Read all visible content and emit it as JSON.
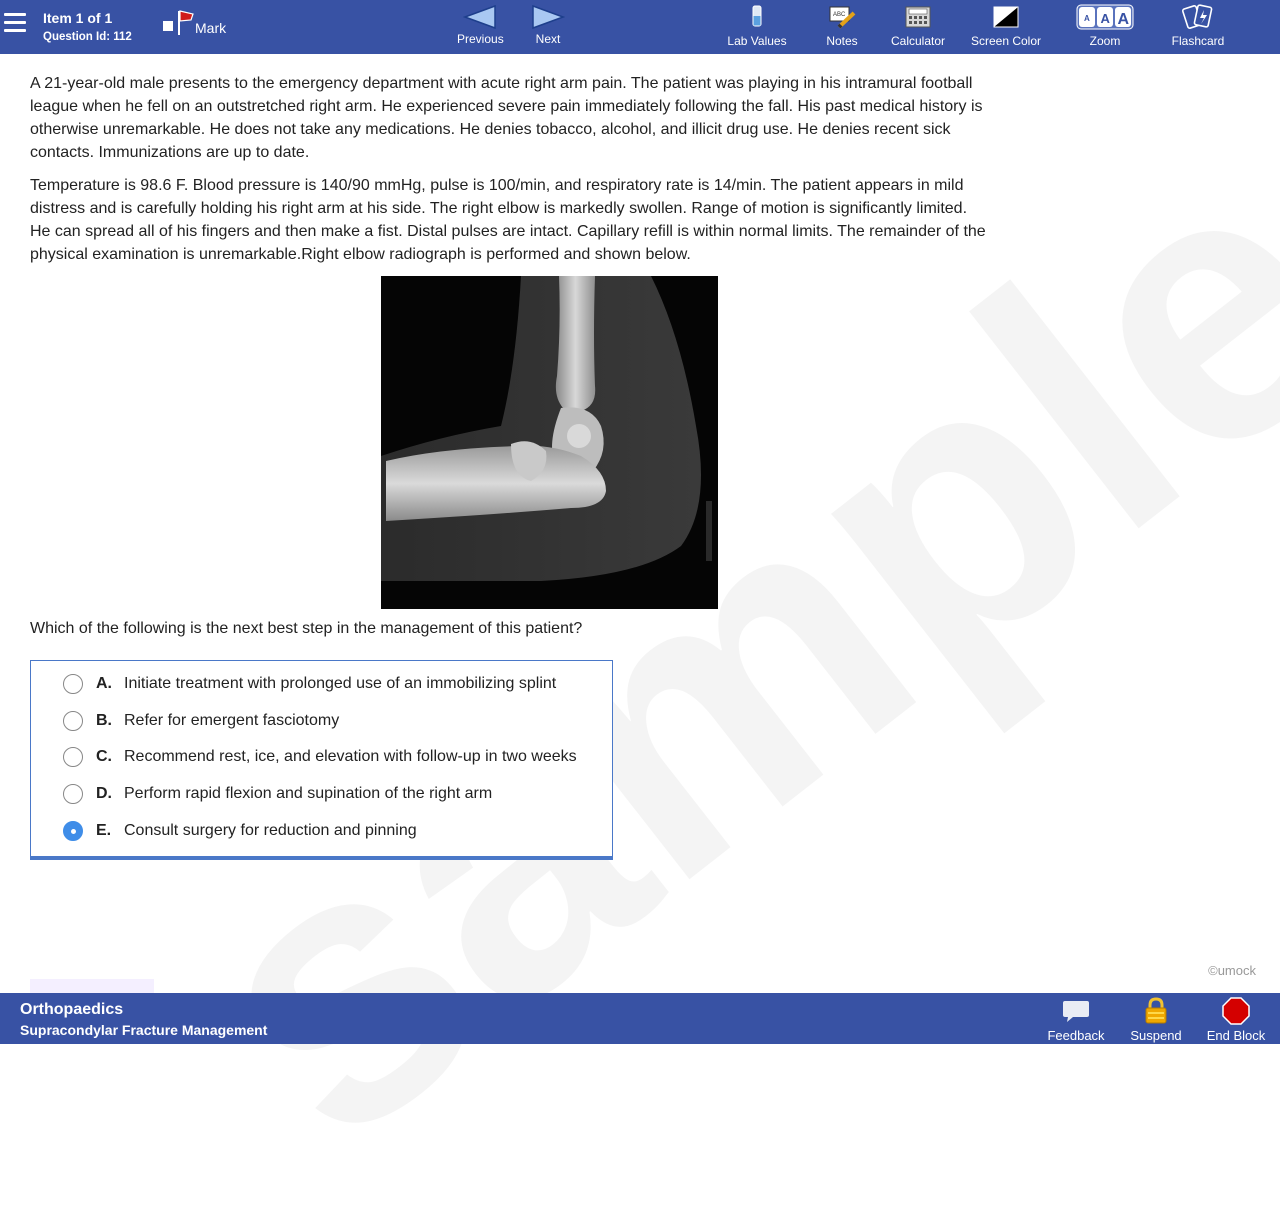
{
  "header": {
    "item_title": "Item 1 of 1",
    "question_id": "Question Id: 112",
    "mark_label": "Mark",
    "previous_label": "Previous",
    "next_label": "Next",
    "tools": {
      "lab_values": "Lab Values",
      "notes": "Notes",
      "calculator": "Calculator",
      "screen_color": "Screen Color",
      "zoom": "Zoom",
      "flashcard": "Flashcard"
    }
  },
  "stem": {
    "paragraph1": "A 21-year-old male presents to the emergency department with acute right arm pain. The patient was playing in his intramural football league when he fell on an outstretched right arm. He experienced severe pain immediately following the fall. His past medical history is otherwise unremarkable. He does not take any medications. He denies tobacco, alcohol, and illicit drug use. He denies recent sick contacts. Immunizations are up to date.",
    "paragraph2": "Temperature is 98.6 F. Blood pressure is 140/90 mmHg, pulse is 100/min, and respiratory rate is 14/min. The patient appears in mild distress and is carefully holding his right arm at his side. The right elbow is markedly swollen. Range of motion is significantly limited. He can spread all of his fingers and then make a fist. Distal pulses are intact. Capillary refill is within normal limits. The remainder of the physical examination is unremarkable.Right elbow radiograph is performed and shown below.",
    "question": "Which of the following is the next best step in the management of this patient?"
  },
  "answers": [
    {
      "letter": "A.",
      "text": "Initiate treatment with prolonged use of an immobilizing splint",
      "selected": false
    },
    {
      "letter": "B.",
      "text": "Refer for emergent fasciotomy",
      "selected": false
    },
    {
      "letter": "C.",
      "text": "Recommend rest, ice, and elevation with follow-up in two weeks",
      "selected": false
    },
    {
      "letter": "D.",
      "text": "Perform rapid flexion and supination of the right arm",
      "selected": false
    },
    {
      "letter": "E.",
      "text": "Consult surgery for reduction and pinning",
      "selected": true
    }
  ],
  "watermark": "sample",
  "copyright": "©umock",
  "footer": {
    "subject": "Orthopaedics",
    "topic": "Supracondylar Fracture Management",
    "feedback": "Feedback",
    "suspend": "Suspend",
    "end_block": "End Block"
  },
  "colors": {
    "bar": "#3852a4",
    "accent": "#3f8de8",
    "answer_border": "#4a78c8"
  }
}
